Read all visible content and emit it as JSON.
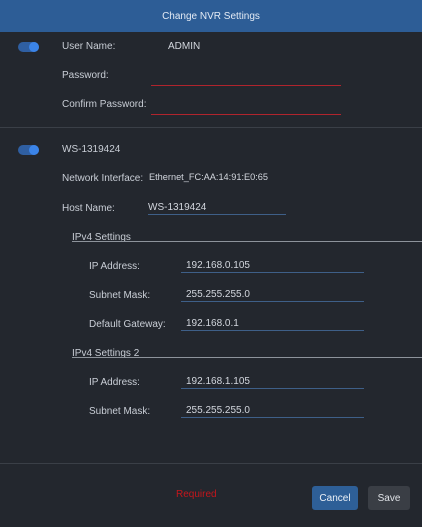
{
  "window": {
    "title": "Change NVR Settings"
  },
  "user_section": {
    "enabled": true,
    "username_label": "User Name:",
    "username_value": "ADMIN",
    "password_label": "Password:",
    "password_value": "",
    "confirm_label": "Confirm Password:",
    "confirm_value": ""
  },
  "device_section": {
    "enabled": true,
    "device_name": "WS-1319424",
    "network_interface_label": "Network Interface:",
    "network_interface_value": "Ethernet_FC:AA:14:91:E0:65",
    "host_name_label": "Host Name:",
    "host_name_value": "WS-1319424",
    "ipv4": {
      "title": "IPv4 Settings",
      "ip_label": "IP Address:",
      "ip_value": "192.168.0.105",
      "subnet_label": "Subnet Mask:",
      "subnet_value": "255.255.255.0",
      "gateway_label": "Default Gateway:",
      "gateway_value": "192.168.0.1"
    },
    "ipv4_2": {
      "title": "IPv4 Settings 2",
      "ip_label": "IP Address:",
      "ip_value": "192.168.1.105",
      "subnet_label": "Subnet Mask:",
      "subnet_value": "255.255.255.0"
    }
  },
  "footer": {
    "required_text": "Required",
    "cancel_label": "Cancel",
    "save_label": "Save"
  },
  "colors": {
    "title_bar": "#2d5d96",
    "background": "#23272e",
    "accent": "#3b84e8",
    "error": "#c4161c"
  }
}
